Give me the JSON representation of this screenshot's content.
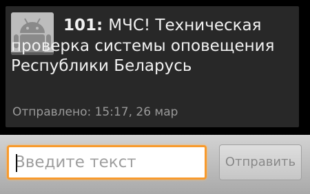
{
  "message": {
    "sender": "101",
    "separator": ": ",
    "body": "МЧС! Техническая проверка системы оповещения Республики Беларусь",
    "sent_info": "Отправлено: 15:17, 26 мар",
    "avatar_icon": "android-robot-icon"
  },
  "compose": {
    "placeholder": "Введите текст",
    "send_label": "Отправить"
  },
  "colors": {
    "input_focus_border": "#f89a2c",
    "bubble_bg": "#282828"
  }
}
